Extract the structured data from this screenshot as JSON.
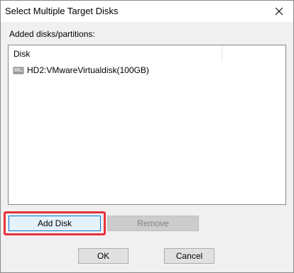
{
  "window": {
    "title": "Select Multiple Target Disks"
  },
  "section_label": "Added disks/partitions:",
  "list": {
    "column_header": "Disk",
    "items": [
      {
        "label": "HD2:VMwareVirtualdisk(100GB)",
        "icon": "hard-disk-icon"
      }
    ]
  },
  "buttons": {
    "add_disk": "Add Disk",
    "remove": "Remove",
    "ok": "OK",
    "cancel": "Cancel"
  },
  "colors": {
    "highlight": "#e8323c",
    "focus_border": "#0078d7"
  }
}
